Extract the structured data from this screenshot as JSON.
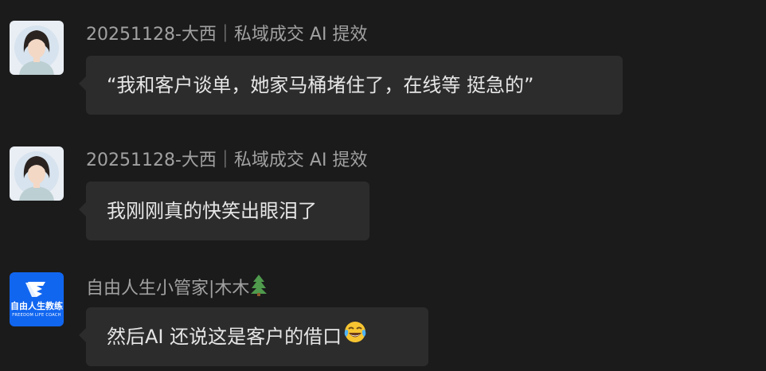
{
  "messages": [
    {
      "sender": "20251128-大西｜私域成交 AI 提效",
      "text": "“我和客户谈单，她家马桶堵住了，在线等 挺急的”",
      "avatar": "woman-photo-avatar"
    },
    {
      "sender": "20251128-大西｜私域成交 AI 提效",
      "text": "我刚刚真的快笑出眼泪了",
      "avatar": "woman-photo-avatar"
    },
    {
      "sender": "自由人生小管家|木木",
      "sender_icon": "tree-icon",
      "text": "然后AI 还说这是客户的借口",
      "text_icon": "laughing-crying-emoji-icon",
      "avatar": "freedom-life-coach-logo",
      "logo_text": "自由人生教练",
      "logo_subtext": "FREEDOM LIFE COACH"
    }
  ],
  "colors": {
    "background": "#1b1b1b",
    "bubble": "#2c2c2c",
    "bubble_text": "#e6e6e6",
    "sender_text": "#a1a1a1",
    "logo_blue": "#1166f0"
  }
}
